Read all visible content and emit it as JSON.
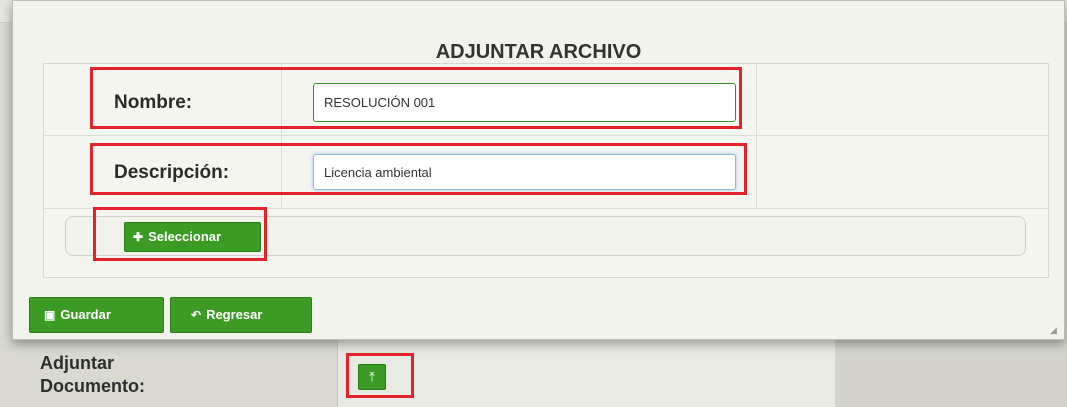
{
  "modal": {
    "title": "ADJUNTAR ARCHIVO",
    "nombre_label": "Nombre:",
    "nombre_value": "RESOLUCIÓN 001",
    "descripcion_label": "Descripción:",
    "descripcion_value": "Licencia ambiental",
    "select_button": "Seleccionar",
    "save_button": "Guardar",
    "back_button": "Regresar"
  },
  "background": {
    "attach_label_line1": "Adjuntar",
    "attach_label_line2": "Documento:"
  },
  "icons": {
    "plus": "plus-icon",
    "save": "floppy-icon",
    "back": "undo-arrow-icon",
    "upload": "upload-icon"
  },
  "colors": {
    "button_green": "#3b9b25",
    "highlight_red": "#e2232b"
  }
}
